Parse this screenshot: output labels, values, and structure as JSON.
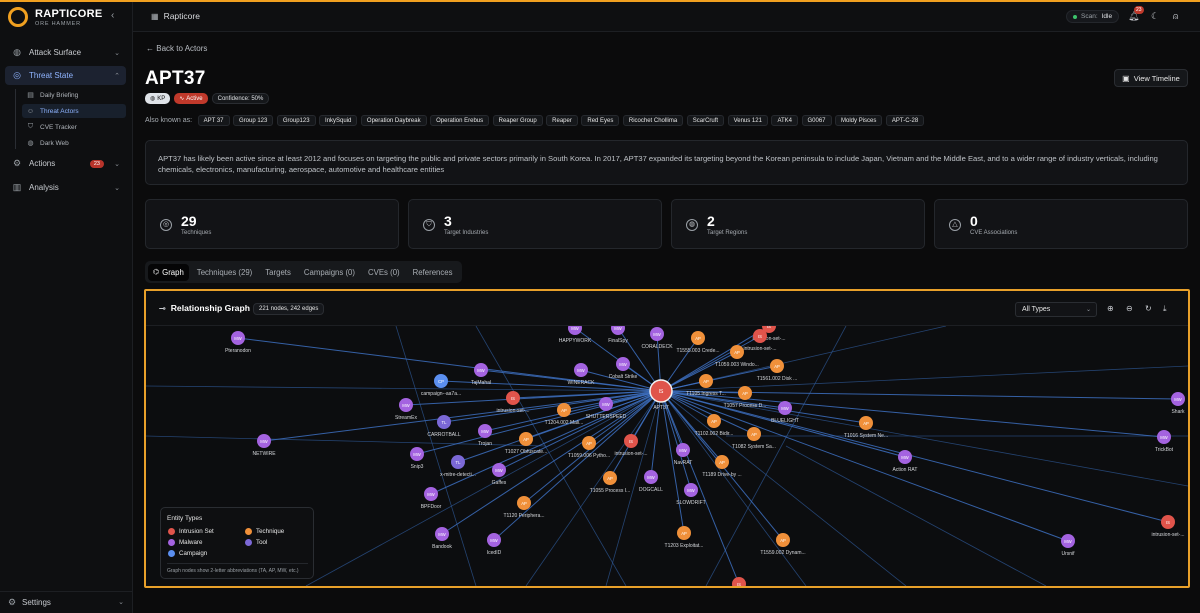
{
  "brand": {
    "name": "RAPTICORE",
    "sub": "ORE HAMMER"
  },
  "sidebar": {
    "items": [
      {
        "label": "Attack Surface",
        "icon": "globe-icon"
      },
      {
        "label": "Threat State",
        "icon": "radar-icon"
      },
      {
        "label": "Actions",
        "icon": "gear-icon",
        "badge": "23"
      },
      {
        "label": "Analysis",
        "icon": "chart-icon"
      }
    ],
    "sub_items": [
      {
        "label": "Daily Briefing",
        "icon": "document-icon"
      },
      {
        "label": "Threat Actors",
        "icon": "users-icon"
      },
      {
        "label": "CVE Tracker",
        "icon": "shield-icon"
      },
      {
        "label": "Dark Web",
        "icon": "globe-icon"
      }
    ],
    "settings_label": "Settings"
  },
  "header": {
    "title": "Rapticore",
    "scan_label": "Scan:",
    "scan_value": "Idle",
    "notifications": "23"
  },
  "page": {
    "back_label": "Back to Actors",
    "title": "APT37",
    "view_timeline": "View Timeline",
    "tags": {
      "kp": "KP",
      "status": "Active",
      "confidence": "Confidence: 50%"
    },
    "aka_label": "Also known as:",
    "aliases": [
      "APT 37",
      "Group 123",
      "Group123",
      "InkySquid",
      "Operation Daybreak",
      "Operation Erebus",
      "Reaper Group",
      "Reaper",
      "Red Eyes",
      "Ricochet Chollima",
      "ScarCruft",
      "Venus 121",
      "ATK4",
      "G0067",
      "Moldy Pisces",
      "APT-C-28"
    ],
    "description": "APT37 has likely been active since at least 2012 and focuses on targeting the public and private sectors primarily in South Korea. In 2017, APT37 expanded its targeting beyond the Korean peninsula to include Japan, Vietnam and the Middle East, and to a wider range of industry verticals, including chemicals, electronics, manufacturing, aerospace, automotive and healthcare entities",
    "stats": [
      {
        "value": "29",
        "label": "Techniques",
        "icon": "target-icon"
      },
      {
        "value": "3",
        "label": "Target Industries",
        "icon": "shield-icon"
      },
      {
        "value": "2",
        "label": "Target Regions",
        "icon": "globe-icon"
      },
      {
        "value": "0",
        "label": "CVE Associations",
        "icon": "warning-icon"
      }
    ],
    "tabs": [
      "Graph",
      "Techniques (29)",
      "Targets",
      "Campaigns (0)",
      "CVEs (0)",
      "References"
    ]
  },
  "graph": {
    "title": "Relationship Graph",
    "count": "221 nodes, 242 edges",
    "filter": "All Types",
    "legend": {
      "title": "Entity Types",
      "items": [
        {
          "label": "Intrusion Set",
          "color": "#e0544b"
        },
        {
          "label": "Technique",
          "color": "#f0903a"
        },
        {
          "label": "Malware",
          "color": "#a463e0"
        },
        {
          "label": "Tool",
          "color": "#7b68d6"
        },
        {
          "label": "Campaign",
          "color": "#5b8ff0"
        }
      ],
      "note": "Graph nodes show 2-letter abbreviations (TA, AP, MW, etc.)"
    },
    "nodes": [
      {
        "abbr": "IS",
        "label": "APT37",
        "type": "intrusion",
        "hub": true
      },
      {
        "abbr": "MW",
        "label": "Pteranodon",
        "type": "malware"
      },
      {
        "abbr": "MW",
        "label": "HAPPYWORK",
        "type": "malware"
      },
      {
        "abbr": "MW",
        "label": "FinalSpy",
        "type": "malware"
      },
      {
        "abbr": "MW",
        "label": "CORALDECK",
        "type": "malware"
      },
      {
        "abbr": "AP",
        "label": "T1555.003 Crede...",
        "type": "technique"
      },
      {
        "abbr": "IS",
        "label": "intrusion-set-...",
        "type": "intrusion"
      },
      {
        "abbr": "IS",
        "label": "intrusion-set-...",
        "type": "intrusion"
      },
      {
        "abbr": "AP",
        "label": "T1059.003 Windo...",
        "type": "technique"
      },
      {
        "abbr": "AP",
        "label": "T1561.002 Disk ...",
        "type": "technique"
      },
      {
        "abbr": "MW",
        "label": "TajMahal",
        "type": "malware"
      },
      {
        "abbr": "CP",
        "label": "campaign--aa7a...",
        "type": "campaign"
      },
      {
        "abbr": "MW",
        "label": "WINERACK",
        "type": "malware"
      },
      {
        "abbr": "MW",
        "label": "Cobalt Strike",
        "type": "malware"
      },
      {
        "abbr": "AP",
        "label": "T1105 Ingress T...",
        "type": "technique"
      },
      {
        "abbr": "AP",
        "label": "T1057 Process D...",
        "type": "technique"
      },
      {
        "abbr": "MW",
        "label": "StreamEx",
        "type": "malware"
      },
      {
        "abbr": "IS",
        "label": "intrusion-set-...",
        "type": "intrusion"
      },
      {
        "abbr": "AP",
        "label": "T1204.002 Mali...",
        "type": "technique"
      },
      {
        "abbr": "MW",
        "label": "SHUTTERSPEED",
        "type": "malware"
      },
      {
        "abbr": "MW",
        "label": "BLUELIGHT",
        "type": "malware"
      },
      {
        "abbr": "AP",
        "label": "T1016 System Ne...",
        "type": "technique"
      },
      {
        "abbr": "TL",
        "label": "CARROTBALL",
        "type": "tool"
      },
      {
        "abbr": "MW",
        "label": "NETWIRE",
        "type": "malware"
      },
      {
        "abbr": "MW",
        "label": "Trojan",
        "type": "malware"
      },
      {
        "abbr": "AP",
        "label": "T1027 Obfuscate...",
        "type": "technique"
      },
      {
        "abbr": "AP",
        "label": "T1059.006 Pytho...",
        "type": "technique"
      },
      {
        "abbr": "IS",
        "label": "intrusion-set-...",
        "type": "intrusion"
      },
      {
        "abbr": "AP",
        "label": "T1102.002 Bidir...",
        "type": "technique"
      },
      {
        "abbr": "AP",
        "label": "T1082 System Sa...",
        "type": "technique"
      },
      {
        "abbr": "MW",
        "label": "Snip3",
        "type": "malware"
      },
      {
        "abbr": "TL",
        "label": "x-mitre-detecti...",
        "type": "tool"
      },
      {
        "abbr": "MW",
        "label": "NavRAT",
        "type": "malware"
      },
      {
        "abbr": "MW",
        "label": "Action RAT",
        "type": "malware"
      },
      {
        "abbr": "MW",
        "label": "TrickBot",
        "type": "malware"
      },
      {
        "abbr": "MW",
        "label": "Shark",
        "type": "malware"
      },
      {
        "abbr": "IS",
        "label": "intrusion-set-...",
        "type": "intrusion"
      },
      {
        "abbr": "MW",
        "label": "Gaffes",
        "type": "malware"
      },
      {
        "abbr": "AP",
        "label": "T1055 Process I...",
        "type": "technique"
      },
      {
        "abbr": "MW",
        "label": "DOGCALL",
        "type": "malware"
      },
      {
        "abbr": "AP",
        "label": "T1189 Drive-by ...",
        "type": "technique"
      },
      {
        "abbr": "MW",
        "label": "BPFDoor",
        "type": "malware"
      },
      {
        "abbr": "AP",
        "label": "T1120 Periphera...",
        "type": "technique"
      },
      {
        "abbr": "MW",
        "label": "SLOWDRIFT",
        "type": "malware"
      },
      {
        "abbr": "MW",
        "label": "Bandook",
        "type": "malware"
      },
      {
        "abbr": "MW",
        "label": "IcedID",
        "type": "malware"
      },
      {
        "abbr": "AP",
        "label": "T1203 Exploitat...",
        "type": "technique"
      },
      {
        "abbr": "AP",
        "label": "T1559.002 Dynam...",
        "type": "technique"
      },
      {
        "abbr": "MW",
        "label": "Ursnif",
        "type": "malware"
      },
      {
        "abbr": "IS",
        "label": "intrusion-set-...",
        "type": "intrusion"
      }
    ]
  }
}
